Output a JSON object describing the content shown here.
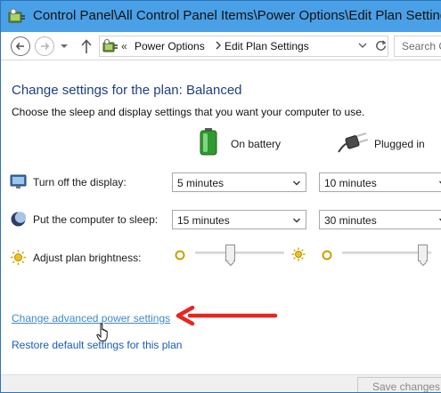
{
  "window": {
    "title": "Control Panel\\All Control Panel Items\\Power Options\\Edit Plan Settings"
  },
  "address_bar": {
    "chevron": "«",
    "breadcrumbs": [
      "Power Options",
      "Edit Plan Settings"
    ],
    "search_placeholder": "Search Co"
  },
  "main": {
    "heading": "Change settings for the plan: Balanced",
    "description": "Choose the sleep and display settings that you want your computer to use.",
    "columns": {
      "battery": "On battery",
      "plugged": "Plugged in"
    },
    "rows": [
      {
        "label": "Turn off the display:",
        "battery_value": "5 minutes",
        "plugged_value": "10 minutes"
      },
      {
        "label": "Put the computer to sleep:",
        "battery_value": "15 minutes",
        "plugged_value": "30 minutes"
      }
    ],
    "brightness": {
      "label": "Adjust plan brightness:",
      "battery_level": 0.38,
      "plugged_level": 0.95
    },
    "links": {
      "advanced": "Change advanced power settings",
      "restore": "Restore default settings for this plan"
    }
  },
  "footer": {
    "save_label": "Save changes"
  },
  "colors": {
    "titlebar": "#4aa0e6",
    "heading": "#1f3f7e",
    "link": "#1a5bb8",
    "annotation_arrow": "#e8261f"
  }
}
